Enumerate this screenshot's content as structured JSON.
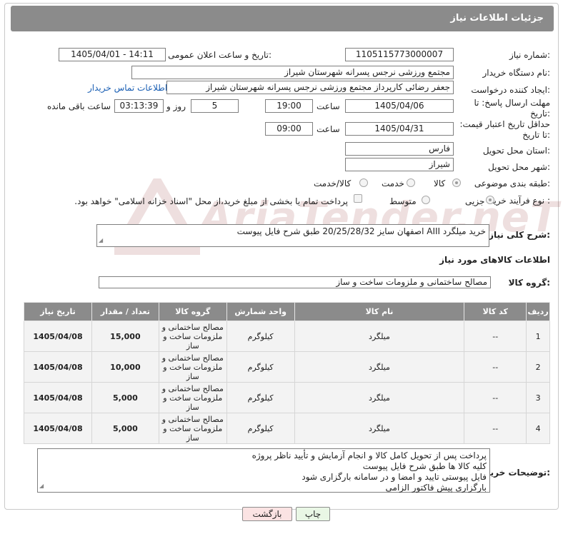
{
  "header": {
    "title": "جزئیات اطلاعات نیاز"
  },
  "form": {
    "need_number": {
      "label": "شماره نیاز:",
      "value": "1105115773000007"
    },
    "announce": {
      "label": "تاریخ و ساعت اعلان عمومی:",
      "value": "1405/04/01 - 14:11"
    },
    "buyer_org": {
      "label": "نام دستگاه خریدار:",
      "value": "مجتمع ورزشی نرجس پسرانه شهرستان شیراز"
    },
    "creator": {
      "label": "ایجاد کننده درخواست:",
      "value": "جعفر رضائی کارپرداز مجتمع ورزشی نرجس پسرانه شهرستان شیراز",
      "contact_link": "اطلاعات تماس خریدار"
    },
    "deadline": {
      "label": "مهلت ارسال پاسخ: تا تاریخ:",
      "date": "1405/04/06",
      "time_label": "ساعت",
      "time": "19:00",
      "days": "5",
      "days_label": "روز و",
      "remaining": "03:13:39",
      "remaining_label": "ساعت باقی مانده"
    },
    "price_validity": {
      "label": "حداقل تاریخ اعتبار قیمت: تا تاریخ:",
      "date": "1405/04/31",
      "time_label": "ساعت",
      "time": "09:00"
    },
    "province": {
      "label": "استان محل تحویل:",
      "value": "فارس"
    },
    "city": {
      "label": "شهر محل تحویل:",
      "value": "شیراز"
    },
    "category": {
      "label": "طبقه بندی موضوعی:",
      "options": [
        "کالا",
        "خدمت",
        "کالا/خدمت"
      ],
      "selected": "کالا"
    },
    "purchase_type": {
      "label": "نوع فرآیند خرید :",
      "options": [
        "جزیی",
        "متوسط"
      ],
      "selected": "جزیی",
      "payment_note": "پرداخت تمام یا بخشی از مبلغ خرید،از محل \"اسناد خزانه اسلامی\" خواهد بود."
    }
  },
  "description": {
    "label": "شرح کلی نیاز:",
    "value": "خرید میلگرد AIII اصفهان سایز 20/25/28/32 طبق شرح فایل پیوست"
  },
  "goods_section": {
    "title": "اطلاعات کالاهای مورد نیاز",
    "group_label": "گروه کالا:",
    "group_value": "مصالح ساختمانی و ملزومات ساخت و ساز"
  },
  "table": {
    "headers": [
      "ردیف",
      "کد کالا",
      "نام کالا",
      "واحد شمارش",
      "گروه کالا",
      "تعداد / مقدار",
      "تاریخ نیاز"
    ],
    "rows": [
      {
        "row": "1",
        "code": "--",
        "name": "میلگرد",
        "unit": "کیلوگرم",
        "group": "مصالح ساختمانی و ملزومات ساخت و ساز",
        "qty": "15,000",
        "date": "1405/04/08"
      },
      {
        "row": "2",
        "code": "--",
        "name": "میلگرد",
        "unit": "کیلوگرم",
        "group": "مصالح ساختمانی و ملزومات ساخت و ساز",
        "qty": "10,000",
        "date": "1405/04/08"
      },
      {
        "row": "3",
        "code": "--",
        "name": "میلگرد",
        "unit": "کیلوگرم",
        "group": "مصالح ساختمانی و ملزومات ساخت و ساز",
        "qty": "5,000",
        "date": "1405/04/08"
      },
      {
        "row": "4",
        "code": "--",
        "name": "میلگرد",
        "unit": "کیلوگرم",
        "group": "مصالح ساختمانی و ملزومات ساخت و ساز",
        "qty": "5,000",
        "date": "1405/04/08"
      }
    ]
  },
  "buyer_notes": {
    "label": "توضیحات خریدار:",
    "lines": [
      "پرداخت پس از تحویل کامل کالا و انجام آزمایش و تأیید ناظر پروژه",
      "کلیه کالا ها طبق شرح فایل پیوست",
      "فایل پیوستی تایید و  امضا و در سامانه بارگزاری شود",
      "بارگزاری پیش فاکتور الزامی"
    ]
  },
  "buttons": {
    "print": "چاپ",
    "back": "بازگشت"
  },
  "colors": {
    "header_bg": "#8b8b8b",
    "link": "#1a5fb4",
    "print_btn": "#e9f7e5",
    "back_btn": "#fbe3e3"
  }
}
